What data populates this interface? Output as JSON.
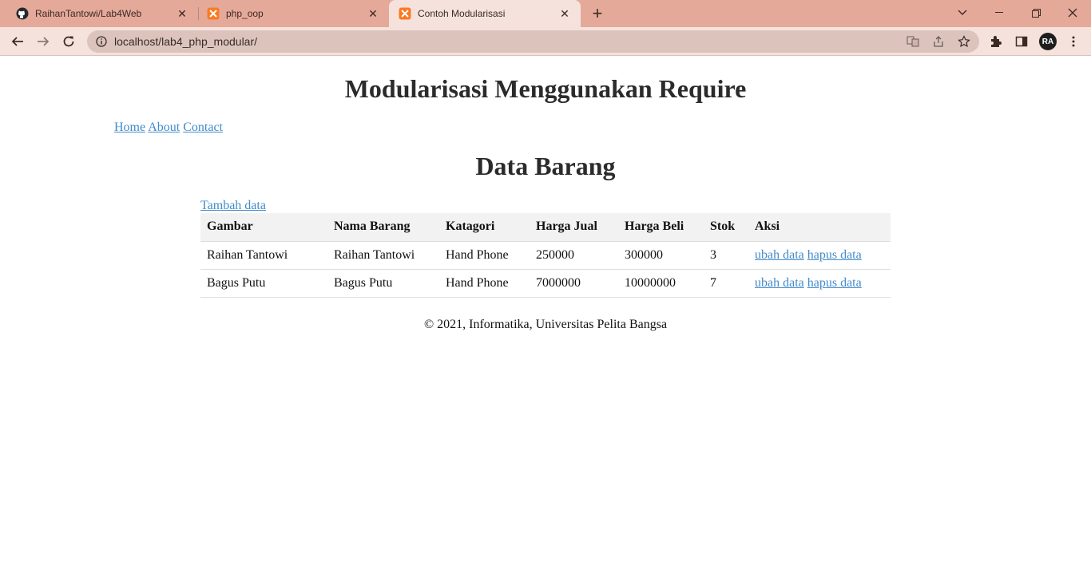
{
  "browser": {
    "tabs": [
      {
        "title": "RaihanTantowi/Lab4Web",
        "icon": "github-icon",
        "active": false
      },
      {
        "title": "php_oop",
        "icon": "xampp-icon",
        "active": false
      },
      {
        "title": "Contoh Modularisasi",
        "icon": "xampp-icon",
        "active": true
      }
    ],
    "url": "localhost/lab4_php_modular/",
    "avatar_initials": "RA"
  },
  "page": {
    "site_title": "Modularisasi Menggunakan Require",
    "nav": {
      "home": "Home",
      "about": "About",
      "contact": "Contact"
    },
    "section_title": "Data Barang",
    "add_link": "Tambah data",
    "table": {
      "headers": [
        "Gambar",
        "Nama Barang",
        "Katagori",
        "Harga Jual",
        "Harga Beli",
        "Stok",
        "Aksi"
      ],
      "rows": [
        {
          "gambar": "Raihan Tantowi",
          "nama": "Raihan Tantowi",
          "kategori": "Hand Phone",
          "harga_jual": "250000",
          "harga_beli": "300000",
          "stok": "3",
          "ubah": "ubah data",
          "hapus": "hapus data"
        },
        {
          "gambar": "Bagus Putu",
          "nama": "Bagus Putu",
          "kategori": "Hand Phone",
          "harga_jual": "7000000",
          "harga_beli": "10000000",
          "stok": "7",
          "ubah": "ubah data",
          "hapus": "hapus data"
        }
      ]
    },
    "footer": "© 2021, Informatika, Universitas Pelita Bangsa"
  },
  "colors": {
    "link": "#428bca",
    "tabbar": "#e5a999",
    "toolbar": "#f5e2dc"
  }
}
